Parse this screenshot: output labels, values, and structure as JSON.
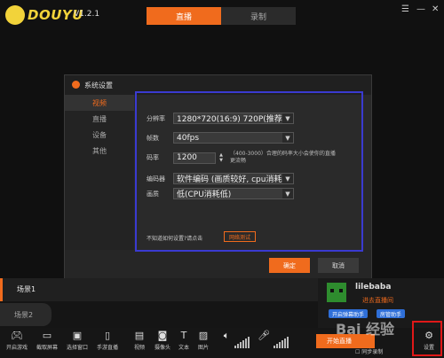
{
  "app": {
    "name": "DOUYU",
    "version": "V1.2.1",
    "brand_color": "#f06b1d"
  },
  "top_tabs": [
    {
      "label": "直播",
      "active": true
    },
    {
      "label": "录制",
      "active": false
    }
  ],
  "dialog": {
    "title": "系统设置",
    "sidebar": [
      {
        "label": "视频",
        "active": true
      },
      {
        "label": "直播",
        "active": false
      },
      {
        "label": "设备",
        "active": false
      },
      {
        "label": "其他",
        "active": false
      }
    ],
    "fields": {
      "resolution": {
        "label": "分辨率",
        "value": "1280*720(16:9) 720P(推荐"
      },
      "framerate": {
        "label": "帧数",
        "value": "40fps"
      },
      "bitrate": {
        "label": "码率",
        "value": "1200",
        "hint": "（400-3000）合理的码率大小会使你的直播更流畅"
      },
      "encoder": {
        "label": "编码器",
        "value": "软件编码 (画质较好, cpu消耗"
      },
      "quality": {
        "label": "画质",
        "value": "低(CPU消耗低)"
      }
    },
    "help_text": "不知道如何设置?请点击",
    "net_test_label": "网络测试",
    "ok_label": "确定",
    "cancel_label": "取消"
  },
  "scenes": [
    {
      "label": "场景1",
      "active": true
    },
    {
      "label": "场景2",
      "active": false
    }
  ],
  "user": {
    "name": "lilebaba",
    "room_link": "进去直播间",
    "danmu_helper": "开启弹幕助手",
    "room_helper": "房管助手"
  },
  "toolbar": {
    "items": [
      {
        "label": "开启游戏",
        "icon": "gamepad-icon"
      },
      {
        "label": "截取屏幕",
        "icon": "monitor-icon"
      },
      {
        "label": "选择窗口",
        "icon": "window-icon"
      },
      {
        "label": "手游直播",
        "icon": "mobile-icon"
      },
      {
        "label": "视频",
        "icon": "video-icon"
      },
      {
        "label": "摄像头",
        "icon": "camera-icon"
      },
      {
        "label": "文本",
        "icon": "text-icon"
      },
      {
        "label": "图片",
        "icon": "image-icon"
      }
    ],
    "start_live_label": "开始直播",
    "sync_record_label": "同步录制",
    "settings_label": "设置"
  },
  "watermark": "Bai 经验"
}
